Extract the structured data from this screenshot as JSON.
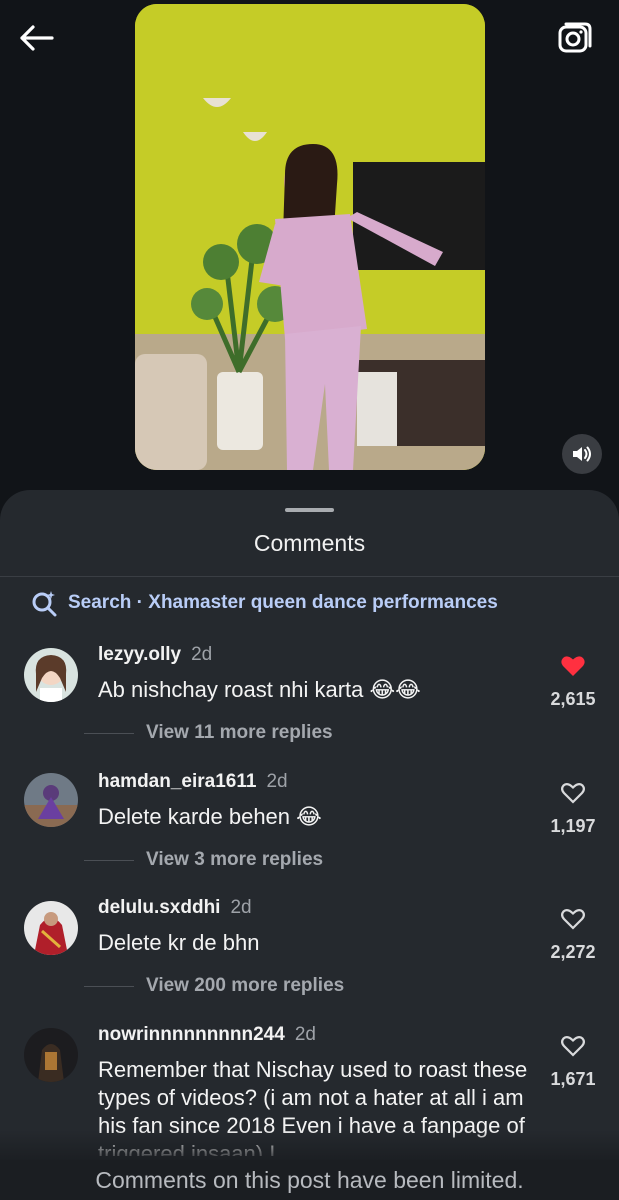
{
  "sheet": {
    "title": "Comments",
    "search_prefix": "Search",
    "search_sep": " · ",
    "search_query": "Xhamaster queen dance performances"
  },
  "comments": [
    {
      "username": "lezyy.olly",
      "time": "2d",
      "text": "Ab nishchay roast nhi karta 😂😂",
      "replies": "View 11 more replies",
      "likes": "2,615",
      "liked": true
    },
    {
      "username": "hamdan_eira1611",
      "time": "2d",
      "text": "Delete karde behen 😂",
      "replies": "View 3 more replies",
      "likes": "1,197",
      "liked": false
    },
    {
      "username": "delulu.sxddhi",
      "time": "2d",
      "text": "Delete kr de bhn",
      "replies": "View 200 more replies",
      "likes": "2,272",
      "liked": false
    },
    {
      "username": "nowrinnnnnnnnn244",
      "time": "2d",
      "text": "Remember that Nischay used to roast these types of videos? (i am not a hater at all i am his fan since 2018 Even i have a fanpage of triggered insaan) I",
      "likes": "1,671",
      "liked": false
    }
  ],
  "footer": {
    "limited_text": "Comments on this post have been limited."
  },
  "colors": {
    "accent_like": "#ff3040",
    "search_link": "#b9cdf7",
    "sheet_bg": "#25292e",
    "video_wall": "#c9d12b"
  },
  "icons": {
    "back": "arrow-left-icon",
    "camera": "camera-icon",
    "mute": "speaker-icon",
    "search": "sparkle-search-icon",
    "like": "heart-icon"
  }
}
